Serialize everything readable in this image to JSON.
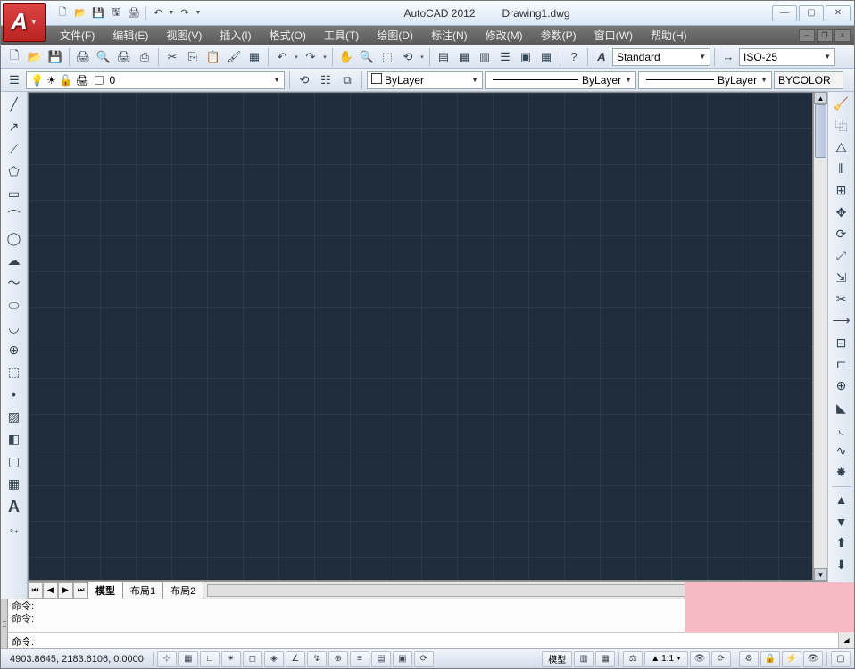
{
  "app": {
    "name": "AutoCAD 2012",
    "document": "Drawing1.dwg"
  },
  "menu": {
    "file": "文件(F)",
    "edit": "编辑(E)",
    "view": "视图(V)",
    "insert": "插入(I)",
    "format": "格式(O)",
    "tools": "工具(T)",
    "draw": "绘图(D)",
    "dimension": "标注(N)",
    "modify": "修改(M)",
    "param": "参数(P)",
    "window": "窗口(W)",
    "help": "帮助(H)"
  },
  "properties": {
    "layer": "0",
    "color_combo": "ByLayer",
    "linetype_combo": "ByLayer",
    "lineweight_combo": "ByLayer",
    "plotstyle": "BYCOLOR",
    "text_style": "Standard",
    "dim_style": "ISO-25"
  },
  "layout_tabs": {
    "model": "模型",
    "layout1": "布局1",
    "layout2": "布局2"
  },
  "command": {
    "history1": "命令:",
    "history2": "命令:",
    "prompt": "命令:"
  },
  "status": {
    "coords": "4903.8645, 2183.6106, 0.0000",
    "model_btn": "模型",
    "scale": "1:1",
    "anno": "▲"
  }
}
